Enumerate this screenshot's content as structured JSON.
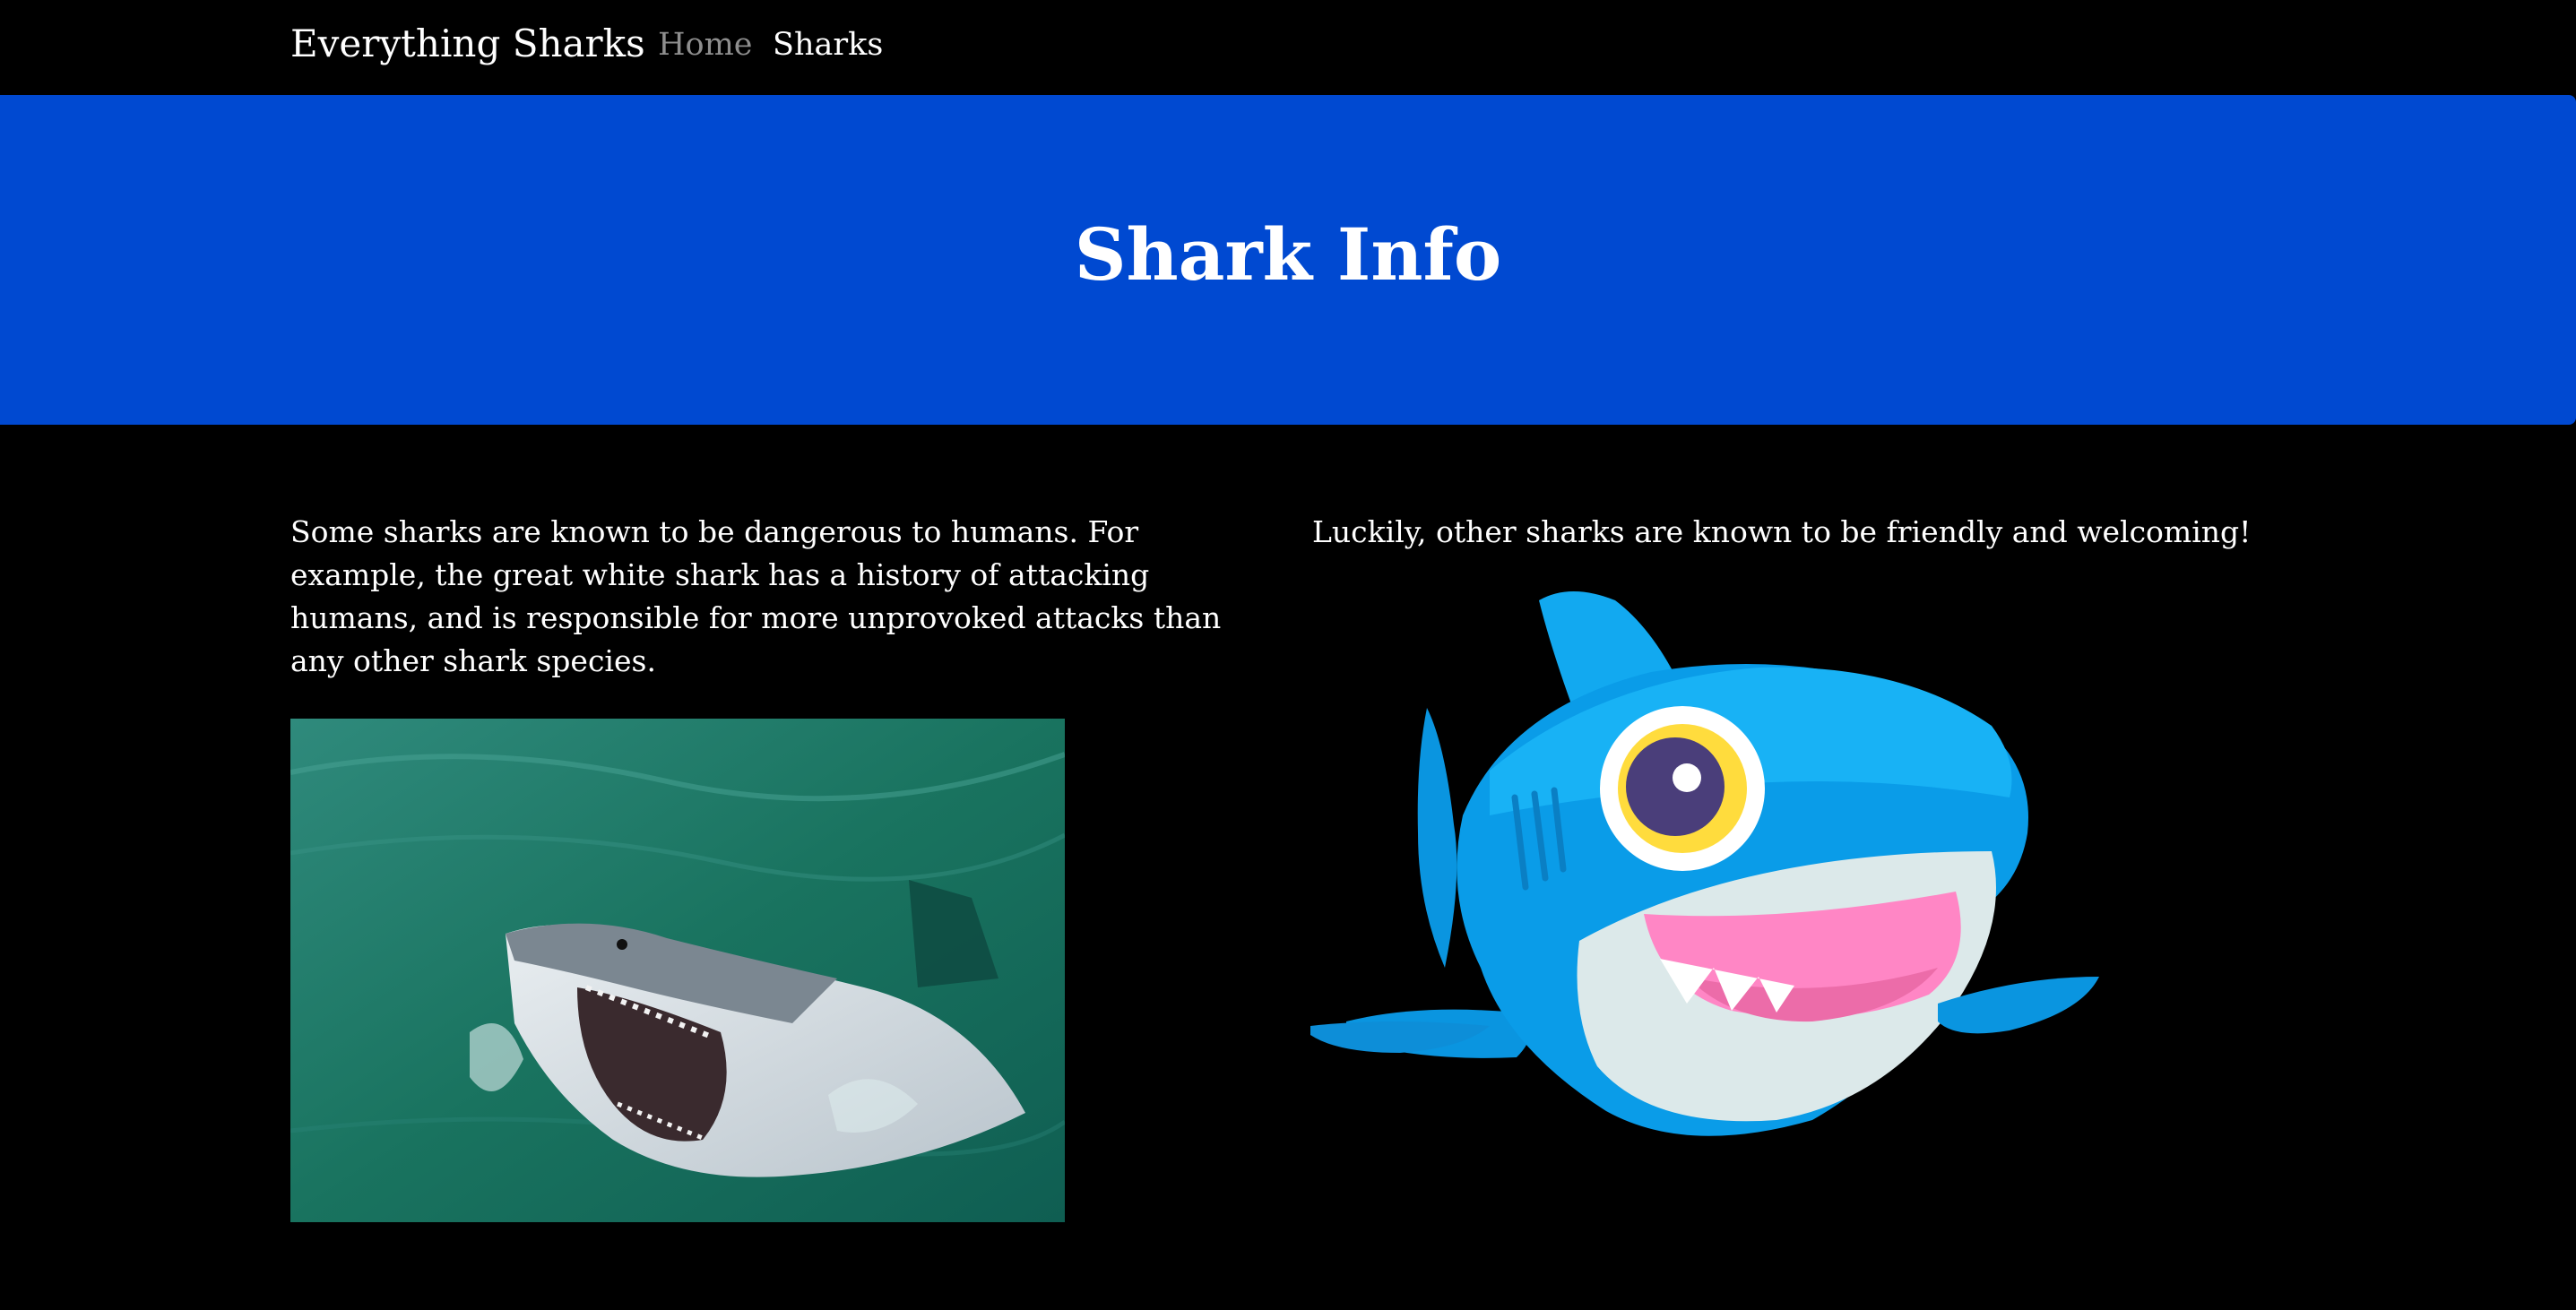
{
  "navbar": {
    "brand": "Everything Sharks",
    "links": [
      {
        "label": "Home"
      },
      {
        "label": "Sharks"
      }
    ]
  },
  "jumbotron": {
    "title": "Shark Info"
  },
  "content": {
    "left_paragraph": "Some sharks are known to be dangerous to humans. For example, the great white shark has a history of attacking humans, and is responsible for more unprovoked attacks than any other shark species.",
    "right_paragraph": "Luckily, other sharks are known to be friendly and welcoming!"
  },
  "colors": {
    "background": "#000000",
    "jumbotron": "#0049d1",
    "nav_inactive": "#8e8e8e",
    "text": "#ffffff"
  }
}
